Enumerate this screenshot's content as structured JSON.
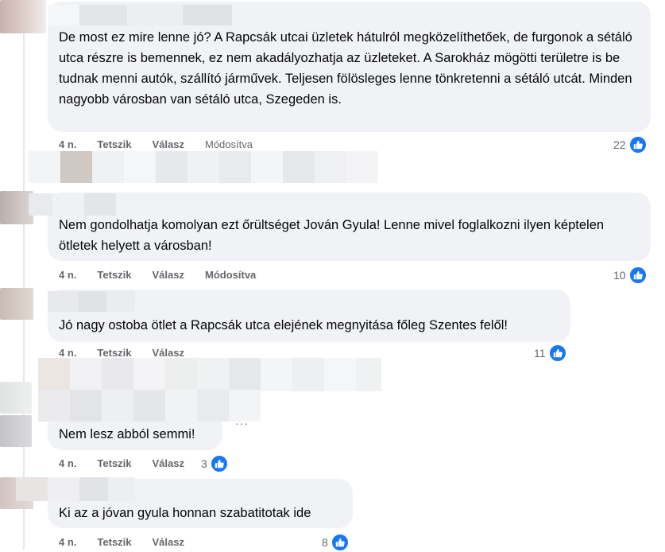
{
  "comments": [
    {
      "text": "De most ez mire lenne jó? A Rapcsák utcai üzletek hátulról megközelíthetőek, de furgonok a sétáló utca részre is bemennek, ez nem akadályozhatja az üzleteket. A Sarokház mögötti területre is be tudnak menni autók, szállító járművek. Teljesen fölösleges lenne tönkretenni a sétáló utcát. Minden nagyobb városban van sétáló utca, Szegeden is.",
      "time": "4 n.",
      "like": "Tetszik",
      "reply": "Válasz",
      "edited": "Módosítva",
      "count": "22"
    },
    {
      "text": "Nem gondolhatja komolyan ezt őrültséget Jován Gyula! Lenne mivel foglalkozni ilyen képtelen ötletek helyett a városban!",
      "time": "4 n.",
      "like": "Tetszik",
      "reply": "Válasz",
      "edited": "Módosítva",
      "count": "10"
    },
    {
      "text": "Jó nagy ostoba ötlet a Rapcsák utca elejének megnyitása főleg Szentes felől!",
      "time": "4 n.",
      "like": "Tetszik",
      "reply": "Válasz",
      "count": "11"
    },
    {
      "text": "Nem lesz abból semmi!",
      "time": "4 n.",
      "like": "Tetszik",
      "reply": "Válasz",
      "count": "3"
    },
    {
      "text": "Ki az a jóvan gyula honnan szabatitotak ide",
      "time": "4 n.",
      "like": "Tetszik",
      "reply": "Válasz",
      "count": "8"
    }
  ],
  "more_dots": "···",
  "icons": {
    "reaction": "like-thumb-icon"
  },
  "colors": {
    "like_blue": "#1877f2",
    "bubble": "#f0f2f5",
    "meta": "#65676b"
  }
}
